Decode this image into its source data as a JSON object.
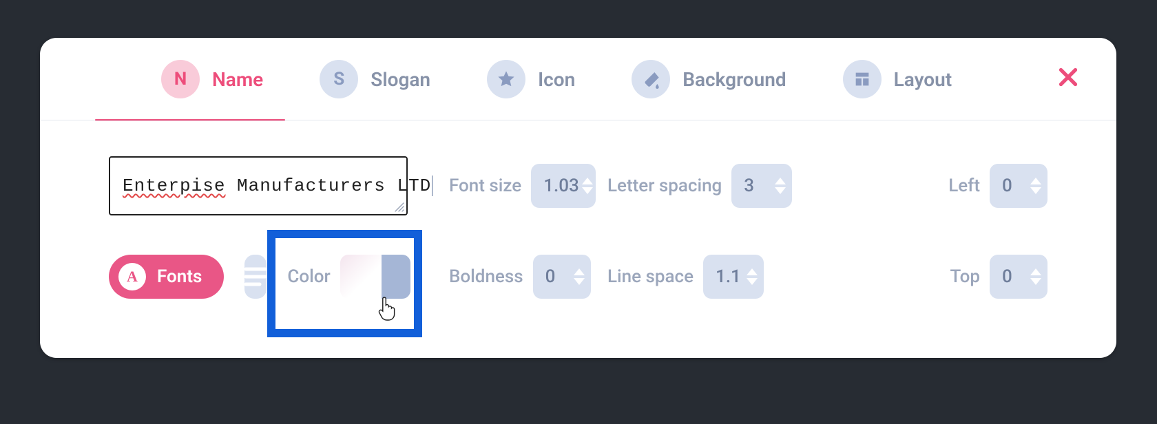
{
  "tabs": {
    "name": {
      "letter": "N",
      "label": "Name"
    },
    "slogan": {
      "letter": "S",
      "label": "Slogan"
    },
    "icon": {
      "label": "Icon"
    },
    "background": {
      "label": "Background"
    },
    "layout": {
      "label": "Layout"
    }
  },
  "name_input": {
    "value": "Enterpise Manufacturers LTD",
    "misspelled_token": "Enterpise",
    "rest": " Manufacturers LTD"
  },
  "row1": {
    "font_size": {
      "label": "Font size",
      "value": "1.03"
    },
    "letter_spacing": {
      "label": "Letter spacing",
      "value": "3"
    },
    "left": {
      "label": "Left",
      "value": "0"
    }
  },
  "row2": {
    "fonts_label": "Fonts",
    "fonts_icon_letter": "A",
    "color_label": "Color",
    "boldness": {
      "label": "Boldness",
      "value": "0"
    },
    "line_space": {
      "label": "Line space",
      "value": "1.1"
    },
    "top": {
      "label": "Top",
      "value": "0"
    }
  }
}
